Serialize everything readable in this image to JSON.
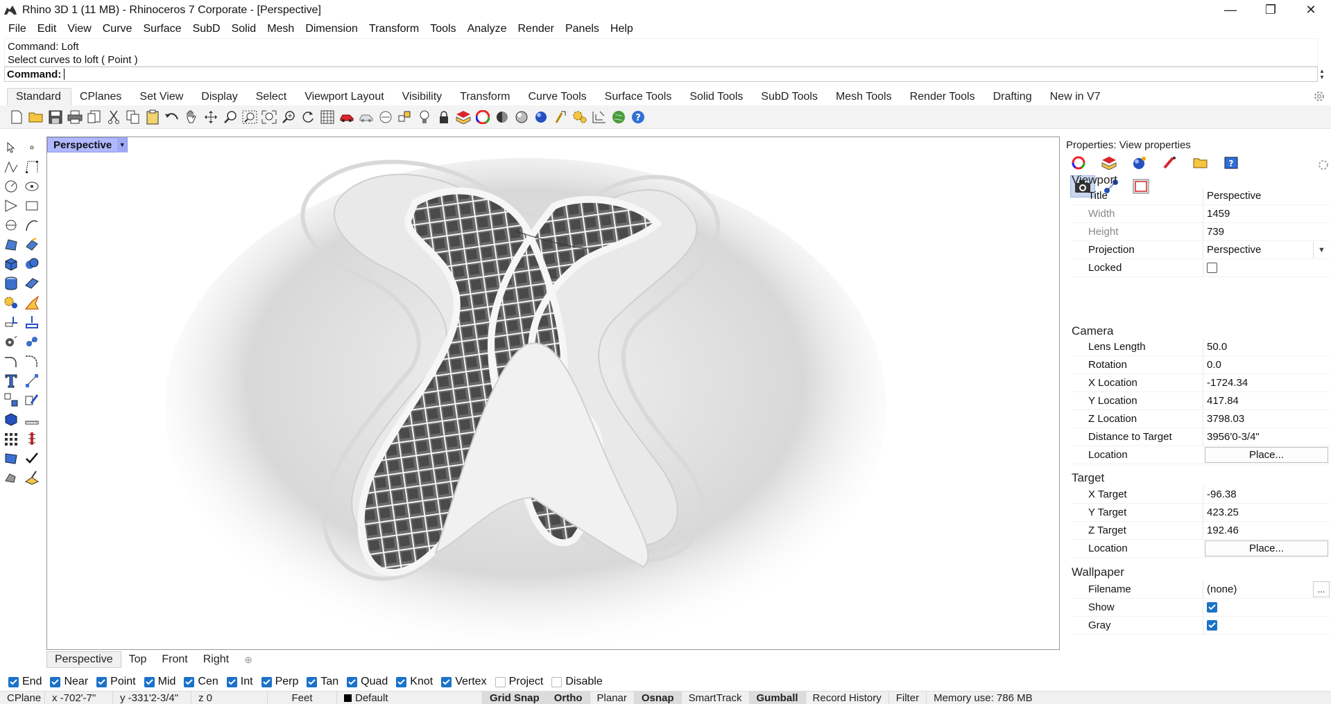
{
  "window": {
    "title": "Rhino 3D 1 (11 MB) - Rhinoceros 7 Corporate - [Perspective]",
    "minimize": "—",
    "maximize": "❐",
    "close": "✕"
  },
  "menu": [
    "File",
    "Edit",
    "View",
    "Curve",
    "Surface",
    "SubD",
    "Solid",
    "Mesh",
    "Dimension",
    "Transform",
    "Tools",
    "Analyze",
    "Render",
    "Panels",
    "Help"
  ],
  "command": {
    "history_line1": "Command: Loft",
    "history_line2": "Select curves to loft ( Point )",
    "prompt_label": "Command:",
    "value": ""
  },
  "toolbar_tabs": [
    "Standard",
    "CPlanes",
    "Set View",
    "Display",
    "Select",
    "Viewport Layout",
    "Visibility",
    "Transform",
    "Curve Tools",
    "Surface Tools",
    "Solid Tools",
    "SubD Tools",
    "Mesh Tools",
    "Render Tools",
    "Drafting",
    "New in V7"
  ],
  "active_toolbar_tab": "Standard",
  "standard_tools": [
    "new-icon",
    "open-icon",
    "save-icon",
    "print-icon",
    "import-icon",
    "cut-icon",
    "copy-icon",
    "paste-icon",
    "undo-icon",
    "pan-icon",
    "rotate-view-icon",
    "zoom-dynamic-icon",
    "zoom-window-icon",
    "zoom-extents-icon",
    "zoom-selected-icon",
    "rotate-icon",
    "four-views-icon",
    "car-icon",
    "hide-icon",
    "show-icon",
    "lock-snap-icon",
    "light-icon",
    "lock-icon",
    "layer-icon",
    "color-wheel-icon",
    "shade-icon",
    "render-sphere-icon",
    "blue-sphere-icon",
    "options-icon",
    "gears-icon",
    "dimension-icon",
    "globe-icon",
    "help-icon"
  ],
  "viewport": {
    "label": "Perspective",
    "tabs": [
      "Perspective",
      "Top",
      "Front",
      "Right"
    ],
    "active_tab": "Perspective",
    "add_tab": "⊕"
  },
  "properties": {
    "title": "Properties: View properties",
    "sections": {
      "viewport": "Viewport",
      "camera": "Camera",
      "target": "Target",
      "wallpaper": "Wallpaper"
    },
    "viewport_rows": {
      "title_label": "Title",
      "title_value": "Perspective",
      "width_label": "Width",
      "width_value": "1459",
      "height_label": "Height",
      "height_value": "739",
      "projection_label": "Projection",
      "projection_value": "Perspective",
      "locked_label": "Locked",
      "locked_value": false
    },
    "camera_rows": {
      "lens_label": "Lens Length",
      "lens_value": "50.0",
      "rotation_label": "Rotation",
      "rotation_value": "0.0",
      "x_label": "X Location",
      "x_value": "-1724.34",
      "y_label": "Y Location",
      "y_value": "417.84",
      "z_label": "Z Location",
      "z_value": "3798.03",
      "dist_label": "Distance to Target",
      "dist_value": "3956'0-3/4\"",
      "loc_label": "Location",
      "loc_button": "Place..."
    },
    "target_rows": {
      "x_label": "X Target",
      "x_value": "-96.38",
      "y_label": "Y Target",
      "y_value": "423.25",
      "z_label": "Z Target",
      "z_value": "192.46",
      "loc_label": "Location",
      "loc_button": "Place..."
    },
    "wallpaper_rows": {
      "filename_label": "Filename",
      "filename_value": "(none)",
      "browse": "...",
      "show_label": "Show",
      "show_value": true,
      "gray_label": "Gray",
      "gray_value": true
    }
  },
  "osnaps": [
    {
      "label": "End",
      "checked": true
    },
    {
      "label": "Near",
      "checked": true
    },
    {
      "label": "Point",
      "checked": true
    },
    {
      "label": "Mid",
      "checked": true
    },
    {
      "label": "Cen",
      "checked": true
    },
    {
      "label": "Int",
      "checked": true
    },
    {
      "label": "Perp",
      "checked": true
    },
    {
      "label": "Tan",
      "checked": true
    },
    {
      "label": "Quad",
      "checked": true
    },
    {
      "label": "Knot",
      "checked": true
    },
    {
      "label": "Vertex",
      "checked": true
    },
    {
      "label": "Project",
      "checked": false
    },
    {
      "label": "Disable",
      "checked": false
    }
  ],
  "status": {
    "cplane": "CPlane",
    "x": "x -702'-7\"",
    "y": "y -331'2-3/4\"",
    "z": "z 0",
    "units": "Feet",
    "layer": "Default",
    "layer_color": "#000000",
    "grid_snap": "Grid Snap",
    "ortho": "Ortho",
    "planar": "Planar",
    "osnap": "Osnap",
    "smarttrack": "SmartTrack",
    "gumball": "Gumball",
    "record_history": "Record History",
    "filter": "Filter",
    "memory": "Memory use: 786 MB"
  },
  "colors": {
    "viewport_label": "#b0b8ff",
    "accent_checkbox": "#1a73c8",
    "selected_icon": "#c9d7ef"
  }
}
